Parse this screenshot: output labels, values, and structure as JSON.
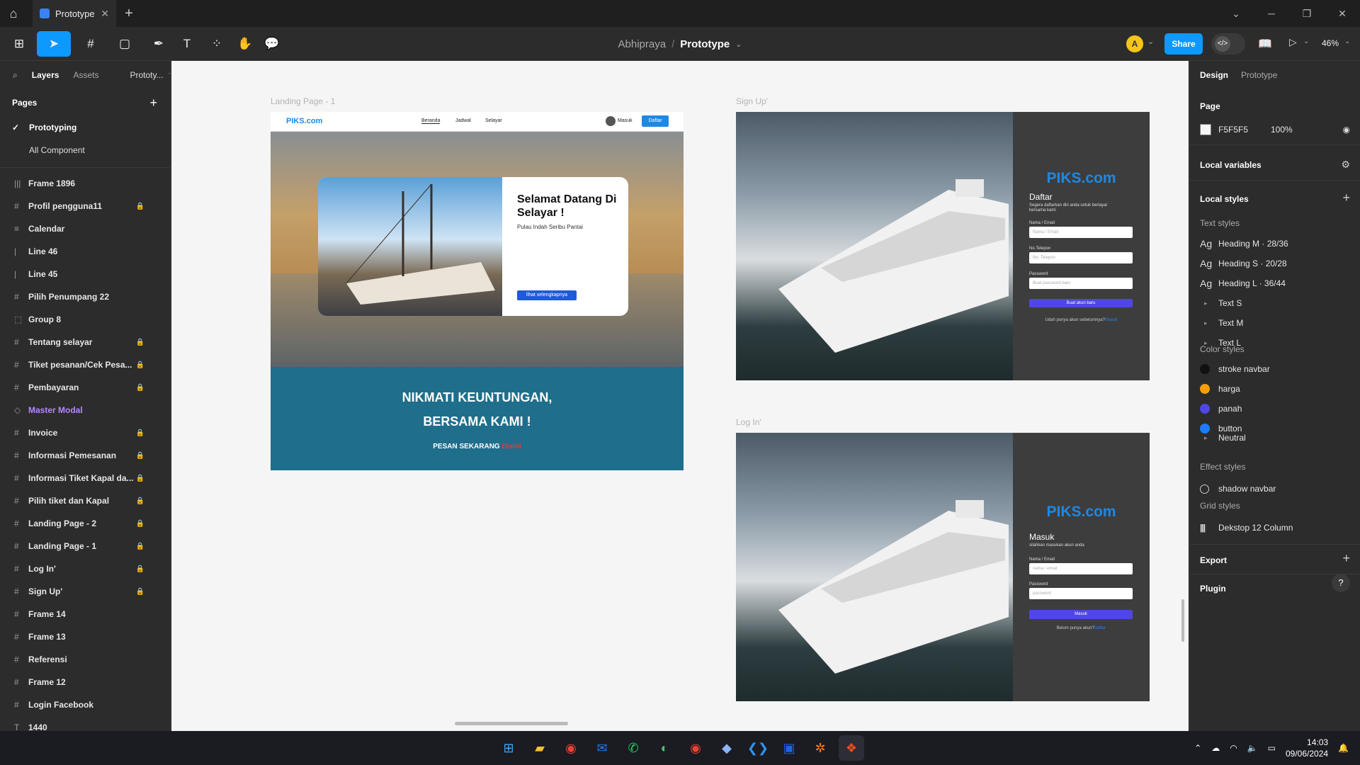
{
  "titlebar": {
    "tab_title": "Prototype",
    "home_icon": "home-icon",
    "new_tab": "+"
  },
  "toolbar": {
    "breadcrumb_team": "Abhipraya",
    "breadcrumb_sep": "/",
    "breadcrumb_file": "Prototype",
    "avatar_letter": "A",
    "share_label": "Share",
    "zoom": "46%"
  },
  "left_panel": {
    "tabs": [
      "Layers",
      "Assets",
      "Prototy..."
    ],
    "pages_title": "Pages",
    "pages": [
      "Prototyping",
      "All Component"
    ],
    "layers": [
      {
        "name": "Frame 1896",
        "icon": "|||",
        "locked": false
      },
      {
        "name": "Profil pengguna11",
        "icon": "#",
        "locked": true
      },
      {
        "name": "Calendar",
        "icon": "≡",
        "locked": false
      },
      {
        "name": "Line 46",
        "icon": "|",
        "locked": false
      },
      {
        "name": "Line 45",
        "icon": "|",
        "locked": false
      },
      {
        "name": "Pilih Penumpang 22",
        "icon": "#",
        "locked": false
      },
      {
        "name": "Group 8",
        "icon": "⬚",
        "locked": false
      },
      {
        "name": "Tentang selayar",
        "icon": "#",
        "locked": true
      },
      {
        "name": "Tiket pesanan/Cek Pesa...",
        "icon": "#",
        "locked": true
      },
      {
        "name": "Pembayaran",
        "icon": "#",
        "locked": true
      },
      {
        "name": "Master Modal",
        "icon": "◇",
        "locked": false
      },
      {
        "name": "Invoice",
        "icon": "#",
        "locked": true
      },
      {
        "name": "Informasi Pemesanan",
        "icon": "#",
        "locked": true
      },
      {
        "name": "Informasi Tiket Kapal da...",
        "icon": "#",
        "locked": true
      },
      {
        "name": "Pilih tiket dan Kapal",
        "icon": "#",
        "locked": true
      },
      {
        "name": "Landing Page - 2",
        "icon": "#",
        "locked": true
      },
      {
        "name": "Landing Page - 1",
        "icon": "#",
        "locked": true
      },
      {
        "name": "Log In'",
        "icon": "#",
        "locked": true
      },
      {
        "name": "Sign Up'",
        "icon": "#",
        "locked": true
      },
      {
        "name": "Frame 14",
        "icon": "#",
        "locked": false
      },
      {
        "name": "Frame 13",
        "icon": "#",
        "locked": false
      },
      {
        "name": "Referensi",
        "icon": "#",
        "locked": false
      },
      {
        "name": "Frame 12",
        "icon": "#",
        "locked": false
      },
      {
        "name": "Login Facebook",
        "icon": "#",
        "locked": false
      },
      {
        "name": "1440",
        "icon": "T",
        "locked": false
      }
    ]
  },
  "canvas": {
    "landing": {
      "label": "Landing Page - 1",
      "brand": "PIKS.com",
      "nav": [
        "Beranda",
        "Jadwal",
        "Selayar"
      ],
      "masuk": "Masuk",
      "daftar": "Daftar",
      "hero_title": "Selamat Datang Di Selayar !",
      "hero_sub": "Pulau Indah Seribu Pantai",
      "hero_button": "lihat selengkapnya",
      "promo_line1": "NIKMATI KEUNTUNGAN,",
      "promo_line2": "BERSAMA KAMI !",
      "order_text": "PESAN SEKARANG",
      "order_highlight": "Disini"
    },
    "signup": {
      "label": "Sign Up'",
      "brand": "PIKS.com",
      "title": "Daftar",
      "sub": "Segera daftarkan diri anda untuk berlayar bersama kami",
      "f1_label": "Nama / Email",
      "f1_ph": "Nama / Email",
      "f2_label": "No.Telepon",
      "f2_ph": "No. Telepon",
      "f3_label": "Password",
      "f3_ph": "Buat password baru",
      "button": "Buat akun baru",
      "footer": "Udah punya akun sebelumnya?",
      "footer_link": "Masuk"
    },
    "login": {
      "label": "Log In'",
      "brand": "PIKS.com",
      "title": "Masuk",
      "sub": "silahkan masukan akun anda",
      "f1_label": "Nama / Email",
      "f1_ph": "nama / email",
      "f2_label": "Password",
      "f2_ph": "password",
      "button": "Masuk",
      "footer": "Belum punya akun?",
      "footer_link": "Daftar"
    }
  },
  "right_panel": {
    "tabs": [
      "Design",
      "Prototype"
    ],
    "page_title": "Page",
    "page_color": "F5F5F5",
    "page_opacity": "100%",
    "local_variables": "Local variables",
    "local_styles": "Local styles",
    "text_styles_title": "Text styles",
    "text_styles": [
      "Heading M · 28/36",
      "Heading S · 20/28",
      "Heading L · 36/44"
    ],
    "text_groups": [
      "Text S",
      "Text M",
      "Text L"
    ],
    "color_styles_title": "Color styles",
    "color_styles": [
      {
        "name": "stroke navbar",
        "color": "#111111"
      },
      {
        "name": "harga",
        "color": "#f59e0b"
      },
      {
        "name": "panah",
        "color": "#4f46e5"
      },
      {
        "name": "button",
        "color": "#1e7bff"
      }
    ],
    "neutral_group": "Neutral",
    "effect_styles_title": "Effect styles",
    "effect_style": "shadow navbar",
    "grid_styles_title": "Grid styles",
    "grid_style": "Dekstop 12 Column",
    "export": "Export",
    "plugin": "Plugin",
    "help": "?"
  },
  "taskbar": {
    "time": "14:03",
    "date": "09/06/2024"
  },
  "colors": {
    "accent": "#0d99ff",
    "share_button": "#0d99ff",
    "brand_blue": "#1e88e5",
    "promo_band": "#1f6e8c"
  }
}
